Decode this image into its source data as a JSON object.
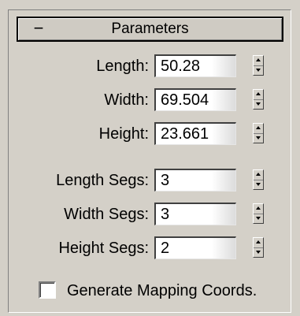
{
  "rollout": {
    "toggle": "−",
    "title": "Parameters"
  },
  "dimensions": [
    {
      "label": "Length:",
      "value": "50.28"
    },
    {
      "label": "Width:",
      "value": "69.504"
    },
    {
      "label": "Height:",
      "value": "23.661"
    }
  ],
  "segments": [
    {
      "label": "Length Segs:",
      "value": "3"
    },
    {
      "label": "Width Segs:",
      "value": "3"
    },
    {
      "label": "Height Segs:",
      "value": "2"
    }
  ],
  "mapping": {
    "label": "Generate Mapping Coords.",
    "checked": false
  }
}
